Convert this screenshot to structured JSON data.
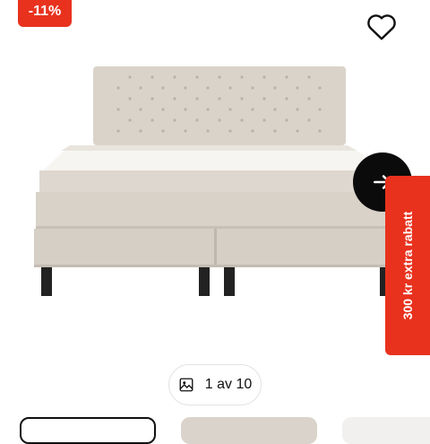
{
  "discount_badge": "-11%",
  "promo_tab": "300 kr extra rabatt",
  "gallery": {
    "counter": "1 av 10",
    "icon": "image-icon"
  },
  "icons": {
    "favorite": "heart-icon",
    "next": "arrow-right-icon"
  },
  "colors": {
    "accent": "#e8321e",
    "button": "#0b0b0b",
    "upholstery": "#d8d2c9"
  }
}
